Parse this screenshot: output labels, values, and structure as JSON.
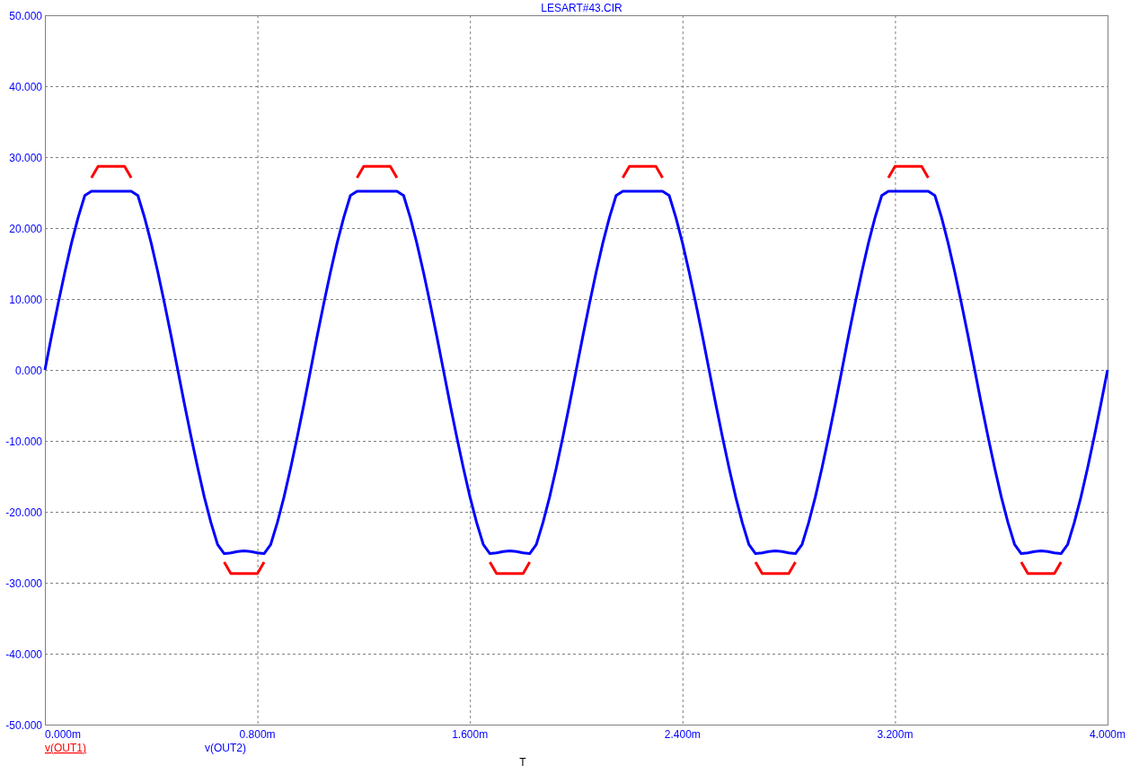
{
  "title": "LESART#43.CIR",
  "chart_data": {
    "type": "line",
    "xlabel": "T",
    "grid": true,
    "xlim": [
      0,
      4
    ],
    "ylim": [
      -50,
      50
    ],
    "xticks": [
      {
        "value": 0,
        "label": "0.000m"
      },
      {
        "value": 0.8,
        "label": "0.800m"
      },
      {
        "value": 1.6,
        "label": "1.600m"
      },
      {
        "value": 2.4,
        "label": "2.400m"
      },
      {
        "value": 3.2,
        "label": "3.200m"
      },
      {
        "value": 4,
        "label": "4.000m"
      }
    ],
    "yticks": [
      {
        "value": 50,
        "label": "50.000"
      },
      {
        "value": 40,
        "label": "40.000"
      },
      {
        "value": 30,
        "label": "30.000"
      },
      {
        "value": 20,
        "label": "20.000"
      },
      {
        "value": 10,
        "label": "10.000"
      },
      {
        "value": 0,
        "label": "0.000"
      },
      {
        "value": -10,
        "label": "-10.000"
      },
      {
        "value": -20,
        "label": "-20.000"
      },
      {
        "value": -30,
        "label": "-30.000"
      },
      {
        "value": -40,
        "label": "-40.000"
      },
      {
        "value": -50,
        "label": "-50.000"
      }
    ],
    "x": [
      0,
      0.025,
      0.05,
      0.075,
      0.1,
      0.125,
      0.15,
      0.175,
      0.2,
      0.225,
      0.25,
      0.275,
      0.3,
      0.325,
      0.35,
      0.375,
      0.4,
      0.425,
      0.45,
      0.475,
      0.5,
      0.525,
      0.55,
      0.575,
      0.6,
      0.625,
      0.65,
      0.675,
      0.7,
      0.725,
      0.75,
      0.775,
      0.8,
      0.825,
      0.85,
      0.875,
      0.9,
      0.925,
      0.95,
      0.975,
      1,
      1.025,
      1.05,
      1.075,
      1.1,
      1.125,
      1.15,
      1.175,
      1.2,
      1.225,
      1.25,
      1.275,
      1.3,
      1.325,
      1.35,
      1.375,
      1.4,
      1.425,
      1.45,
      1.475,
      1.5,
      1.525,
      1.55,
      1.575,
      1.6,
      1.625,
      1.65,
      1.675,
      1.7,
      1.725,
      1.75,
      1.775,
      1.8,
      1.825,
      1.85,
      1.875,
      1.9,
      1.925,
      1.95,
      1.975,
      2,
      2.025,
      2.05,
      2.075,
      2.1,
      2.125,
      2.15,
      2.175,
      2.2,
      2.225,
      2.25,
      2.275,
      2.3,
      2.325,
      2.35,
      2.375,
      2.4,
      2.425,
      2.45,
      2.475,
      2.5,
      2.525,
      2.55,
      2.575,
      2.6,
      2.625,
      2.65,
      2.675,
      2.7,
      2.725,
      2.75,
      2.775,
      2.8,
      2.825,
      2.85,
      2.875,
      2.9,
      2.925,
      2.95,
      2.975,
      3,
      3.025,
      3.05,
      3.075,
      3.1,
      3.125,
      3.15,
      3.175,
      3.2,
      3.225,
      3.25,
      3.275,
      3.3,
      3.325,
      3.35,
      3.375,
      3.4,
      3.425,
      3.45,
      3.475,
      3.5,
      3.525,
      3.55,
      3.575,
      3.6,
      3.625,
      3.65,
      3.675,
      3.7,
      3.725,
      3.75,
      3.775,
      3.8,
      3.825,
      3.85,
      3.875,
      3.9,
      3.925,
      3.95,
      3.975,
      4
    ],
    "series": [
      {
        "name": "v(OUT1)",
        "color": "#ff0000",
        "values": [
          null,
          null,
          null,
          null,
          null,
          null,
          null,
          27.1,
          28.7,
          28.7,
          28.7,
          28.7,
          28.7,
          27.1,
          null,
          null,
          null,
          null,
          null,
          null,
          null,
          null,
          null,
          null,
          null,
          null,
          null,
          -27.1,
          -28.7,
          -28.7,
          -28.7,
          -28.7,
          -28.7,
          -27.1,
          null,
          null,
          null,
          null,
          null,
          null,
          null,
          null,
          null,
          null,
          null,
          null,
          null,
          27.1,
          28.7,
          28.7,
          28.7,
          28.7,
          28.7,
          27.1,
          null,
          null,
          null,
          null,
          null,
          null,
          null,
          null,
          null,
          null,
          null,
          null,
          null,
          -27.1,
          -28.7,
          -28.7,
          -28.7,
          -28.7,
          -28.7,
          -27.1,
          null,
          null,
          null,
          null,
          null,
          null,
          null,
          null,
          null,
          null,
          null,
          null,
          null,
          27.1,
          28.7,
          28.7,
          28.7,
          28.7,
          28.7,
          27.1,
          null,
          null,
          null,
          null,
          null,
          null,
          null,
          null,
          null,
          null,
          null,
          null,
          null,
          -27.1,
          -28.7,
          -28.7,
          -28.7,
          -28.7,
          -28.7,
          -27.1,
          null,
          null,
          null,
          null,
          null,
          null,
          null,
          null,
          null,
          null,
          null,
          null,
          null,
          27.1,
          28.7,
          28.7,
          28.7,
          28.7,
          28.7,
          27.1,
          null,
          null,
          null,
          null,
          null,
          null,
          null,
          null,
          null,
          null,
          null,
          null,
          null,
          -27.1,
          -28.7,
          -28.7,
          -28.7,
          -28.7,
          -28.7,
          -27.1,
          null,
          null,
          null,
          null,
          null,
          null,
          null
        ]
      },
      {
        "name": "v(OUT2)",
        "color": "#0000ff",
        "values": [
          0,
          4.8,
          9.4,
          13.8,
          17.9,
          21.5,
          24.6,
          25.2,
          25.2,
          25.2,
          25.2,
          25.2,
          25.2,
          25.2,
          24.6,
          21.5,
          17.9,
          13.8,
          9.4,
          4.8,
          0,
          -4.8,
          -9.4,
          -13.8,
          -17.9,
          -21.5,
          -24.6,
          -25.9,
          -25.8,
          -25.6,
          -25.5,
          -25.6,
          -25.8,
          -25.9,
          -24.6,
          -21.5,
          -17.9,
          -13.8,
          -9.4,
          -4.8,
          0,
          4.8,
          9.4,
          13.8,
          17.9,
          21.5,
          24.6,
          25.2,
          25.2,
          25.2,
          25.2,
          25.2,
          25.2,
          25.2,
          24.6,
          21.5,
          17.9,
          13.8,
          9.4,
          4.8,
          0,
          -4.8,
          -9.4,
          -13.8,
          -17.9,
          -21.5,
          -24.6,
          -25.9,
          -25.8,
          -25.6,
          -25.5,
          -25.6,
          -25.8,
          -25.9,
          -24.6,
          -21.5,
          -17.9,
          -13.8,
          -9.4,
          -4.8,
          0,
          4.8,
          9.4,
          13.8,
          17.9,
          21.5,
          24.6,
          25.2,
          25.2,
          25.2,
          25.2,
          25.2,
          25.2,
          25.2,
          24.6,
          21.5,
          17.9,
          13.8,
          9.4,
          4.8,
          0,
          -4.8,
          -9.4,
          -13.8,
          -17.9,
          -21.5,
          -24.6,
          -25.9,
          -25.8,
          -25.6,
          -25.5,
          -25.6,
          -25.8,
          -25.9,
          -24.6,
          -21.5,
          -17.9,
          -13.8,
          -9.4,
          -4.8,
          0,
          4.8,
          9.4,
          13.8,
          17.9,
          21.5,
          24.6,
          25.2,
          25.2,
          25.2,
          25.2,
          25.2,
          25.2,
          25.2,
          24.6,
          21.5,
          17.9,
          13.8,
          9.4,
          4.8,
          0,
          -4.8,
          -9.4,
          -13.8,
          -17.9,
          -21.5,
          -24.6,
          -25.9,
          -25.8,
          -25.6,
          -25.5,
          -25.6,
          -25.8,
          -25.9,
          -24.6,
          -21.5,
          -17.9,
          -13.8,
          -9.4,
          -4.8,
          0
        ]
      }
    ]
  },
  "legend": [
    {
      "selected": true
    },
    {
      "selected": false
    }
  ]
}
